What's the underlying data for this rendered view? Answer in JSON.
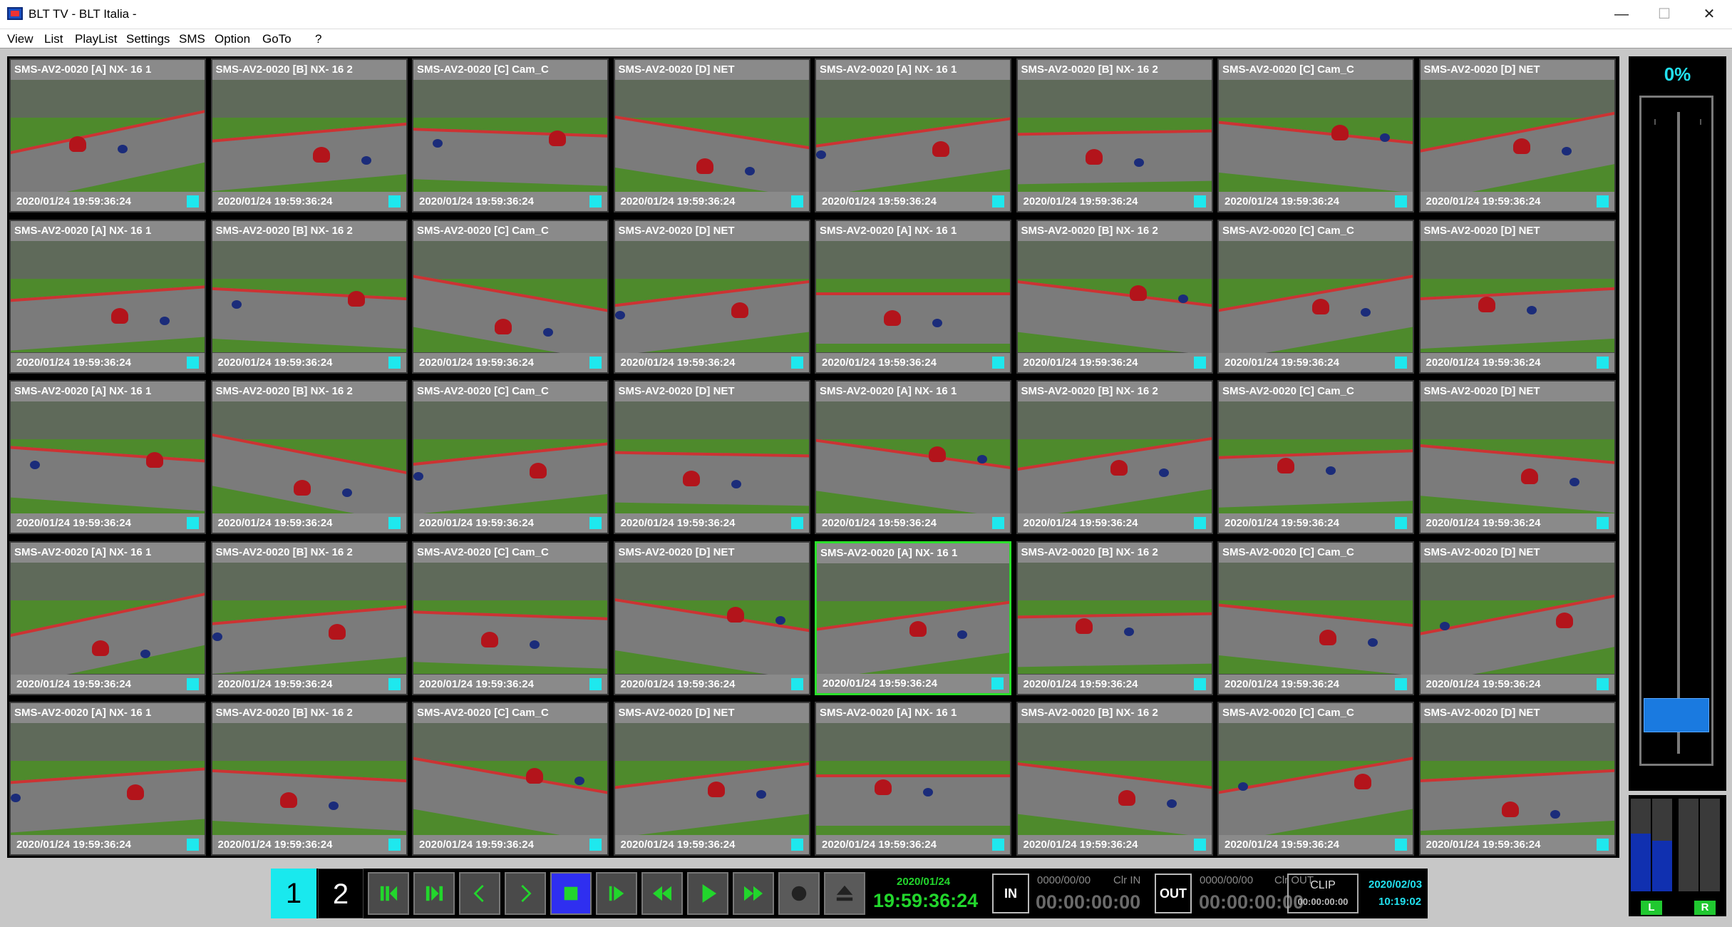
{
  "window": {
    "title": "BLT TV - BLT Italia -",
    "controls": {
      "minimize": "—",
      "maximize": "☐",
      "close": "✕"
    }
  },
  "menu": {
    "items": [
      "View",
      "List",
      "PlayList",
      "Settings",
      "SMS",
      "Option",
      "GoTo",
      "?"
    ]
  },
  "grid": {
    "selected_index": 28,
    "status_color": "#1ee8ee",
    "selected_border_color": "#2be02b",
    "tiles": [
      {
        "label": "SMS-AV2-0020 [A] NX- 16 1",
        "timestamp": "2020/01/24 19:59:36:24"
      },
      {
        "label": "SMS-AV2-0020 [B] NX- 16 2",
        "timestamp": "2020/01/24 19:59:36:24"
      },
      {
        "label": "SMS-AV2-0020 [C] Cam_C",
        "timestamp": "2020/01/24 19:59:36:24"
      },
      {
        "label": "SMS-AV2-0020 [D] NET",
        "timestamp": "2020/01/24 19:59:36:24"
      },
      {
        "label": "SMS-AV2-0020 [A] NX- 16 1",
        "timestamp": "2020/01/24 19:59:36:24"
      },
      {
        "label": "SMS-AV2-0020 [B] NX- 16 2",
        "timestamp": "2020/01/24 19:59:36:24"
      },
      {
        "label": "SMS-AV2-0020 [C] Cam_C",
        "timestamp": "2020/01/24 19:59:36:24"
      },
      {
        "label": "SMS-AV2-0020 [D] NET",
        "timestamp": "2020/01/24 19:59:36:24"
      },
      {
        "label": "SMS-AV2-0020 [A] NX- 16 1",
        "timestamp": "2020/01/24 19:59:36:24"
      },
      {
        "label": "SMS-AV2-0020 [B] NX- 16 2",
        "timestamp": "2020/01/24 19:59:36:24"
      },
      {
        "label": "SMS-AV2-0020 [C] Cam_C",
        "timestamp": "2020/01/24 19:59:36:24"
      },
      {
        "label": "SMS-AV2-0020 [D] NET",
        "timestamp": "2020/01/24 19:59:36:24"
      },
      {
        "label": "SMS-AV2-0020 [A] NX- 16 1",
        "timestamp": "2020/01/24 19:59:36:24"
      },
      {
        "label": "SMS-AV2-0020 [B] NX- 16 2",
        "timestamp": "2020/01/24 19:59:36:24"
      },
      {
        "label": "SMS-AV2-0020 [C] Cam_C",
        "timestamp": "2020/01/24 19:59:36:24"
      },
      {
        "label": "SMS-AV2-0020 [D] NET",
        "timestamp": "2020/01/24 19:59:36:24"
      },
      {
        "label": "SMS-AV2-0020 [A] NX- 16 1",
        "timestamp": "2020/01/24 19:59:36:24"
      },
      {
        "label": "SMS-AV2-0020 [B] NX- 16 2",
        "timestamp": "2020/01/24 19:59:36:24"
      },
      {
        "label": "SMS-AV2-0020 [C] Cam_C",
        "timestamp": "2020/01/24 19:59:36:24"
      },
      {
        "label": "SMS-AV2-0020 [D] NET",
        "timestamp": "2020/01/24 19:59:36:24"
      },
      {
        "label": "SMS-AV2-0020 [A] NX- 16 1",
        "timestamp": "2020/01/24 19:59:36:24"
      },
      {
        "label": "SMS-AV2-0020 [B] NX- 16 2",
        "timestamp": "2020/01/24 19:59:36:24"
      },
      {
        "label": "SMS-AV2-0020 [C] Cam_C",
        "timestamp": "2020/01/24 19:59:36:24"
      },
      {
        "label": "SMS-AV2-0020 [D] NET",
        "timestamp": "2020/01/24 19:59:36:24"
      },
      {
        "label": "SMS-AV2-0020 [A] NX- 16 1",
        "timestamp": "2020/01/24 19:59:36:24"
      },
      {
        "label": "SMS-AV2-0020 [B] NX- 16 2",
        "timestamp": "2020/01/24 19:59:36:24"
      },
      {
        "label": "SMS-AV2-0020 [C] Cam_C",
        "timestamp": "2020/01/24 19:59:36:24"
      },
      {
        "label": "SMS-AV2-0020 [D] NET",
        "timestamp": "2020/01/24 19:59:36:24"
      },
      {
        "label": "SMS-AV2-0020 [A] NX- 16 1",
        "timestamp": "2020/01/24 19:59:36:24"
      },
      {
        "label": "SMS-AV2-0020 [B] NX- 16 2",
        "timestamp": "2020/01/24 19:59:36:24"
      },
      {
        "label": "SMS-AV2-0020 [C] Cam_C",
        "timestamp": "2020/01/24 19:59:36:24"
      },
      {
        "label": "SMS-AV2-0020 [D] NET",
        "timestamp": "2020/01/24 19:59:36:24"
      },
      {
        "label": "SMS-AV2-0020 [A] NX- 16 1",
        "timestamp": "2020/01/24 19:59:36:24"
      },
      {
        "label": "SMS-AV2-0020 [B] NX- 16 2",
        "timestamp": "2020/01/24 19:59:36:24"
      },
      {
        "label": "SMS-AV2-0020 [C] Cam_C",
        "timestamp": "2020/01/24 19:59:36:24"
      },
      {
        "label": "SMS-AV2-0020 [D] NET",
        "timestamp": "2020/01/24 19:59:36:24"
      },
      {
        "label": "SMS-AV2-0020 [A] NX- 16 1",
        "timestamp": "2020/01/24 19:59:36:24"
      },
      {
        "label": "SMS-AV2-0020 [B] NX- 16 2",
        "timestamp": "2020/01/24 19:59:36:24"
      },
      {
        "label": "SMS-AV2-0020 [C] Cam_C",
        "timestamp": "2020/01/24 19:59:36:24"
      },
      {
        "label": "SMS-AV2-0020 [D] NET",
        "timestamp": "2020/01/24 19:59:36:24"
      }
    ]
  },
  "audio": {
    "percent": "0%",
    "fader_level": 0,
    "accent_color": "#22e0ee",
    "meters": [
      {
        "label": "L",
        "level": 0.62
      },
      {
        "label": "R",
        "level": 0.55
      }
    ]
  },
  "transport": {
    "pages": [
      "1",
      "2"
    ],
    "active_page": "1",
    "buttons": [
      {
        "name": "prev-clip-button",
        "icon": "skip-back-icon"
      },
      {
        "name": "next-clip-button",
        "icon": "skip-forward-icon"
      },
      {
        "name": "step-back-button",
        "icon": "chevron-left-icon"
      },
      {
        "name": "step-forward-button",
        "icon": "chevron-right-icon"
      },
      {
        "name": "stop-button",
        "icon": "stop-icon"
      },
      {
        "name": "play-from-start-button",
        "icon": "play-bar-icon"
      },
      {
        "name": "rewind-button",
        "icon": "rewind-icon"
      },
      {
        "name": "play-button",
        "icon": "play-icon"
      },
      {
        "name": "fast-forward-button",
        "icon": "fast-forward-icon"
      },
      {
        "name": "record-button",
        "icon": "record-icon"
      },
      {
        "name": "eject-button",
        "icon": "eject-icon"
      }
    ],
    "current_date": "2020/01/24",
    "current_time": "19:59:36:24",
    "in_label": "IN",
    "in_date": "0000/00/00",
    "in_clear": "Clr IN",
    "in_time": "00:00:00:00",
    "out_label": "OUT",
    "out_date": "0000/00/00",
    "out_clear": "Clr OUT",
    "out_time": "00:00:00:00",
    "clip_label": "CLIP",
    "clip_time": "00:00:00:00",
    "system_date": "2020/02/03",
    "system_time": "10:19:02",
    "time_color": "#22d62c"
  }
}
